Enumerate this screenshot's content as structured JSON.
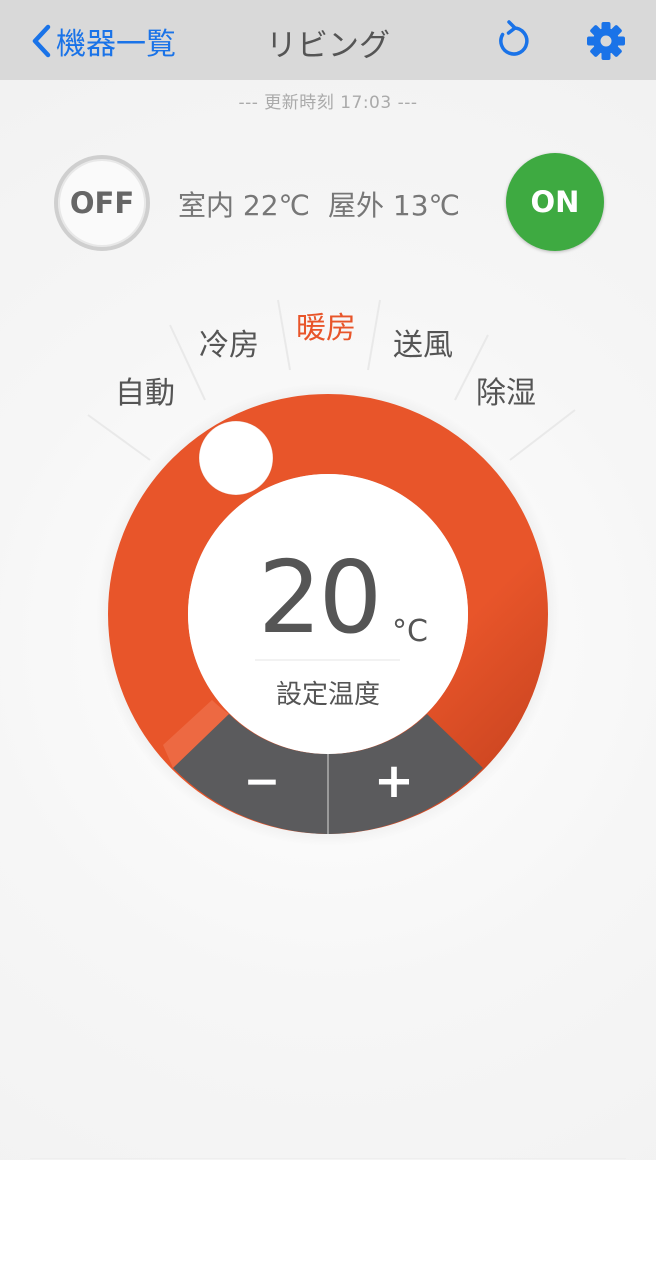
{
  "nav": {
    "back_label": "機器一覧",
    "title": "リビング"
  },
  "status": {
    "update_time": "--- 更新時刻 17:03 ---",
    "indoor": "室内 22℃",
    "outdoor": "屋外 13℃"
  },
  "power": {
    "off_label": "OFF",
    "on_label": "ON"
  },
  "modes": {
    "auto": "自動",
    "cool": "冷房",
    "heat": "暖房",
    "fan": "送風",
    "dry": "除湿",
    "selected": "暖房"
  },
  "dial": {
    "setpoint": "20",
    "unit": "°C",
    "label": "設定温度",
    "minus_label": "−",
    "plus_label": "+"
  },
  "colors": {
    "accent": "#1a73e8",
    "heat": "#e8552a",
    "on_green": "#3eaa41",
    "button_gray": "#5b5b5d"
  },
  "icons": {
    "back": "chevron-left-icon",
    "refresh": "refresh-icon",
    "settings": "gear-icon"
  }
}
